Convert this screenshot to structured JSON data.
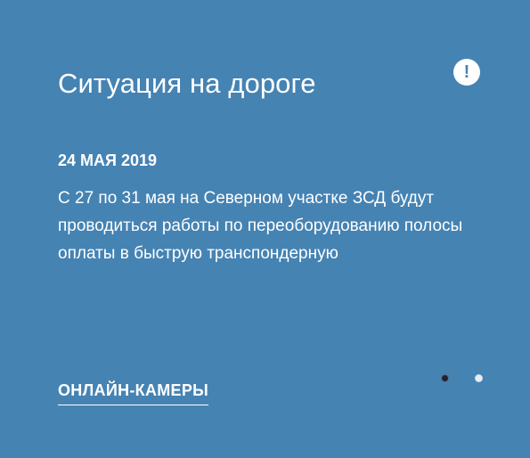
{
  "widget": {
    "title": "Ситуация на дороге",
    "alert_glyph": "!",
    "news": {
      "date": "24 МАЯ 2019",
      "text": "С 27 по 31 мая на Северном участке ЗСД будут проводиться работы по переоборудованию полосы оплаты в быструю транспондерную"
    },
    "link_label": "ОНЛАЙН-КАМЕРЫ",
    "pagination": {
      "total": 2,
      "active": 1
    }
  },
  "colors": {
    "background": "#4583b3",
    "text": "#ffffff",
    "dot_active": "#1f2530",
    "dot_inactive": "#e7eef6"
  },
  "icons": {
    "alert": "exclamation-circle-icon"
  }
}
